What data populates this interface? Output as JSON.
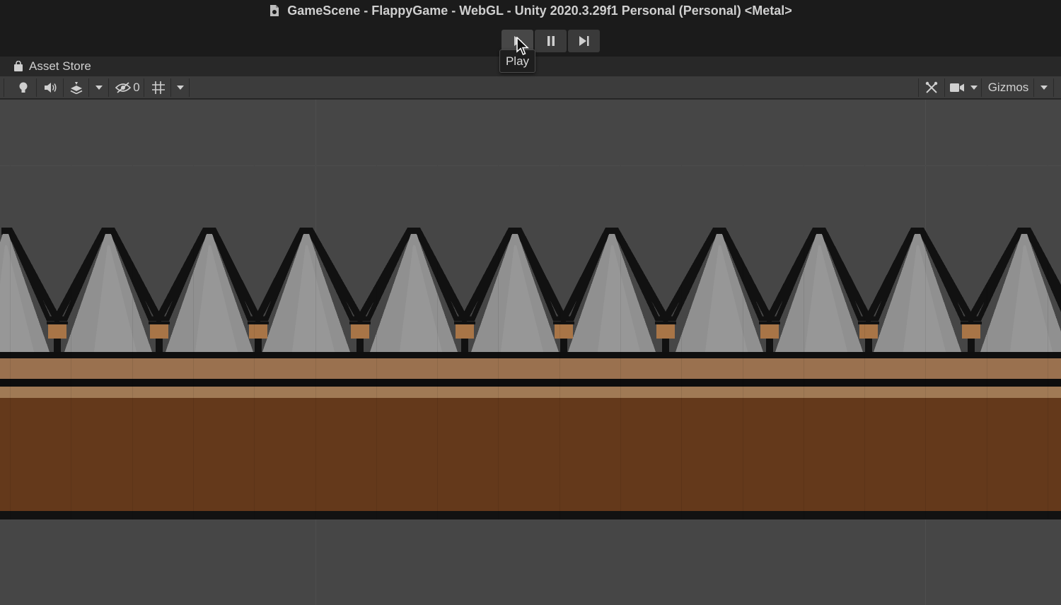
{
  "window": {
    "title": "GameScene - FlappyGame - WebGL - Unity 2020.3.29f1 Personal (Personal) <Metal>"
  },
  "playbar": {
    "tooltip": "Play",
    "buttons": [
      "play-icon",
      "pause-icon",
      "step-icon"
    ]
  },
  "tabs": {
    "asset_store": "Asset Store"
  },
  "scene_toolbar": {
    "hidden_count": "0",
    "gizmos_label": "Gizmos"
  },
  "colors": {
    "title_bg": "#1b1b1b",
    "toolbar_bg": "#3c3c3c",
    "scene_bg": "#464646",
    "ground_light": "#9a714f",
    "ground_dark": "#64391b",
    "spike_gray": "#909090",
    "spike_base": "#a87547"
  }
}
